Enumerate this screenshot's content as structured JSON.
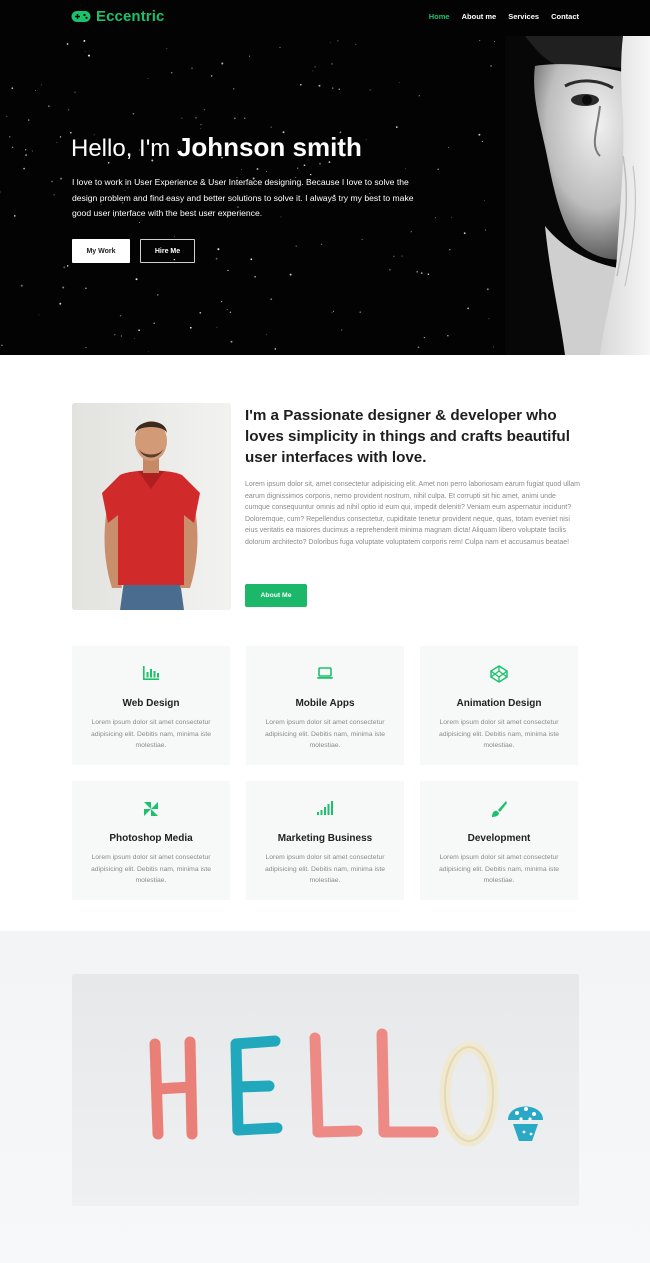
{
  "header": {
    "logo_text": "Eccentric",
    "nav": [
      {
        "label": "Home",
        "active": true
      },
      {
        "label": "About me",
        "active": false
      },
      {
        "label": "Services",
        "active": false
      },
      {
        "label": "Contact",
        "active": false
      }
    ]
  },
  "hero": {
    "greeting": "Hello, I'm ",
    "name": "Johnson smith",
    "description": "I love to work in User Experience & User Interface designing. Because I love to solve the design problem and find easy and better solutions to solve it. I always try my best to make good user interface with the best user experience.",
    "primary_button": "My Work",
    "secondary_button": "Hire Me"
  },
  "about": {
    "heading": "I'm a Passionate designer & developer who loves simplicity in things and crafts beautiful user interfaces with love.",
    "text": "Lorem ipsum dolor sit, amet consectetur adipisicing elit. Amet non perro laboriosam earum fugiat quod ullam earum dignissimos corporis, nemo provident nostrum, nihil culpa. Et corrupti sit hic amet, animi unde cumque consequuntur omnis ad nihil optio id eum qui, impedit deleniti? Veniam eum aspernatur incidunt? Doloremque, cum? Repellendus consectetur, cupiditate tenetur provident neque, quas, totam eveniet nisi eius veritatis ea maiores ducimus a reprehenderit minima magnam dicta! Aliquam libero voluptate facilis dolorum architecto? Doloribus fuga voluptate voluptatem corporis rem! Culpa nam et accusamus beatae!",
    "button": "About Me"
  },
  "services": [
    {
      "icon": "bar-chart-icon",
      "title": "Web Design",
      "text": "Lorem ipsum dolor sit amet consectetur adipisicing elit. Debitis nam, minima iste molestiae."
    },
    {
      "icon": "laptop-icon",
      "title": "Mobile Apps",
      "text": "Lorem ipsum dolor sit amet consectetur adipisicing elit. Debitis nam, minima iste molestiae."
    },
    {
      "icon": "codepen-icon",
      "title": "Animation Design",
      "text": "Lorem ipsum dolor sit amet consectetur adipisicing elit. Debitis nam, minima iste molestiae."
    },
    {
      "icon": "pinwheel-icon",
      "title": "Photoshop Media",
      "text": "Lorem ipsum dolor sit amet consectetur adipisicing elit. Debitis nam, minima iste molestiae."
    },
    {
      "icon": "signal-bars-icon",
      "title": "Marketing Business",
      "text": "Lorem ipsum dolor sit amet consectetur adipisicing elit. Debitis nam, minima iste molestiae."
    },
    {
      "icon": "brush-icon",
      "title": "Development",
      "text": "Lorem ipsum dolor sit amet consectetur adipisicing elit. Debitis nam, minima iste molestiae."
    }
  ],
  "banner": {
    "word": "HELLO"
  },
  "colors": {
    "accent": "#1cc16c",
    "hero_bg": "#030303",
    "card_bg": "#f7f8f8"
  }
}
